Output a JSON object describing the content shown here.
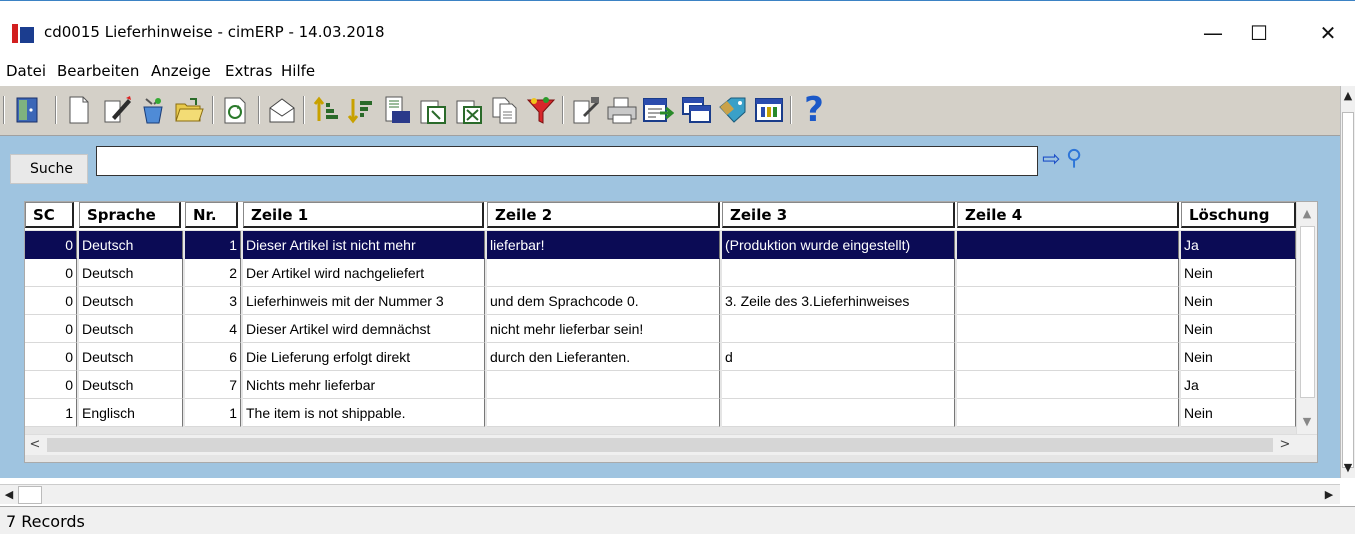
{
  "window": {
    "title": "cd0015 Lieferhinweise - cimERP - 14.03.2018",
    "minimize_glyph": "—",
    "maximize_glyph": "☐",
    "close_glyph": "✕"
  },
  "menu": [
    "Datei",
    "Bearbeiten",
    "Anzeige",
    "Extras",
    "Hilfe"
  ],
  "toolbar": {
    "help_glyph": "?",
    "icons": [
      "exit-icon",
      "new-document-icon",
      "edit-icon",
      "delete-icon",
      "open-folder-icon",
      "refresh-icon",
      "mail-icon",
      "sort-ascending-icon",
      "sort-descending-icon",
      "numeric-filter-icon",
      "export-icon",
      "excel-export-icon",
      "copy-icon",
      "filter-icon",
      "properties-icon",
      "print-icon",
      "import-icon",
      "windows-icon",
      "tag-icon",
      "columns-icon",
      "help-icon"
    ]
  },
  "search": {
    "label": "Suche",
    "value": "",
    "go_glyph": "⇨",
    "search_glyph": "⚲"
  },
  "table": {
    "columns": [
      "SC",
      "Sprache",
      "Nr.",
      "Zeile 1",
      "Zeile 2",
      "Zeile 3",
      "Zeile 4",
      "Löschung"
    ],
    "rows": [
      [
        "0",
        "Deutsch",
        "1",
        "Dieser Artikel ist nicht mehr",
        "lieferbar!",
        "(Produktion wurde eingestellt)",
        "",
        "Ja"
      ],
      [
        "0",
        "Deutsch",
        "2",
        "Der Artikel wird nachgeliefert",
        "",
        "",
        "",
        "Nein"
      ],
      [
        "0",
        "Deutsch",
        "3",
        "Lieferhinweis mit der Nummer 3",
        "und dem Sprachcode 0.",
        "3. Zeile des 3.Lieferhinweises",
        "",
        "Nein"
      ],
      [
        "0",
        "Deutsch",
        "4",
        "Dieser Artikel wird demnächst",
        "nicht mehr lieferbar sein!",
        "",
        "",
        "Nein"
      ],
      [
        "0",
        "Deutsch",
        "6",
        "Die Lieferung erfolgt direkt",
        "durch den Lieferanten.",
        "d",
        "",
        "Nein"
      ],
      [
        "0",
        "Deutsch",
        "7",
        "Nichts mehr lieferbar",
        "",
        "",
        "",
        "Ja"
      ],
      [
        "1",
        "Englisch",
        "1",
        "The item is not shippable.",
        "",
        "",
        "",
        "Nein"
      ]
    ],
    "selected_row": 0
  },
  "status": {
    "records": "7 Records"
  },
  "colors": {
    "selection": "#0b0b55",
    "content_background": "#9fc4e0",
    "toolbar_background": "#d4d0c8"
  }
}
